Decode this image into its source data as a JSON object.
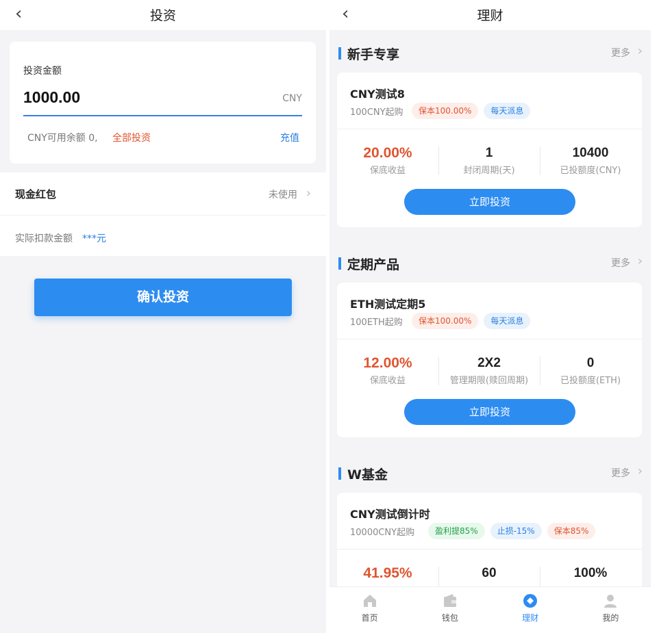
{
  "left": {
    "nav": {
      "back": "‹",
      "title": "投资"
    },
    "amount": {
      "label": "投资金额",
      "value": "1000.00",
      "unit": "CNY",
      "balance": "CNY可用余额 0,",
      "all_invest": "全部投资",
      "recharge": "充值"
    },
    "redpacket": {
      "label": "现金红包",
      "value": "未使用",
      "chevron": "›"
    },
    "deduct": {
      "label": "实际扣款金额",
      "value": "***元"
    },
    "confirm_button": "确认投资"
  },
  "right": {
    "nav": {
      "back": "‹",
      "title": "理财"
    },
    "more_label": "更多",
    "chevron": "›",
    "sections": [
      {
        "title": "新手专享",
        "card": {
          "name": "CNY测试8",
          "min": "100CNY起购",
          "tags": [
            {
              "text": "保本100.00%",
              "style": "red"
            },
            {
              "text": "每天派息",
              "style": "blue"
            }
          ],
          "stats": [
            {
              "value": "20.00%",
              "label": "保底收益"
            },
            {
              "value": "1",
              "label": "封闭周期(天)"
            },
            {
              "value": "10400",
              "label": "已投额度(CNY)"
            }
          ],
          "button": "立即投资"
        }
      },
      {
        "title": "定期产品",
        "card": {
          "name": "ETH测试定期5",
          "min": "100ETH起购",
          "tags": [
            {
              "text": "保本100.00%",
              "style": "red"
            },
            {
              "text": "每天派息",
              "style": "blue"
            }
          ],
          "stats": [
            {
              "value": "12.00%",
              "label": "保底收益"
            },
            {
              "value": "2X2",
              "label": "管理期限(赎回周期)"
            },
            {
              "value": "0",
              "label": "已投额度(ETH)"
            }
          ],
          "button": "立即投资"
        }
      },
      {
        "title": "W基金",
        "card": {
          "name": "CNY测试倒计时",
          "min": "10000CNY起购",
          "tags": [
            {
              "text": "盈利提85%",
              "style": "green"
            },
            {
              "text": "止损-15%",
              "style": "blue"
            },
            {
              "text": "保本85%",
              "style": "red"
            }
          ],
          "stats": [
            {
              "value": "41.95%",
              "label": ""
            },
            {
              "value": "60",
              "label": ""
            },
            {
              "value": "100%",
              "label": ""
            }
          ],
          "button": ""
        }
      }
    ],
    "tabbar": [
      {
        "label": "首页",
        "icon": "home-icon",
        "active": false
      },
      {
        "label": "钱包",
        "icon": "wallet-icon",
        "active": false
      },
      {
        "label": "理财",
        "icon": "finance-icon",
        "active": true
      },
      {
        "label": "我的",
        "icon": "user-icon",
        "active": false
      }
    ],
    "colors": {
      "accent": "#2d8cf0",
      "red": "#e0542f",
      "inactive_icon": "#c8c8c8"
    }
  }
}
